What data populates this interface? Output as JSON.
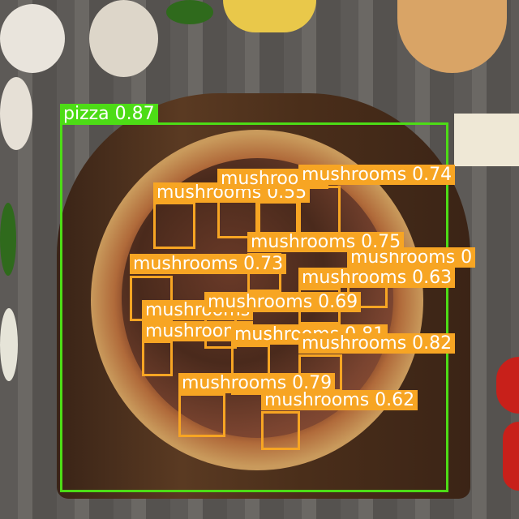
{
  "detections": [
    {
      "label": "pizza 0.87",
      "color": "#4ddc16"
    },
    {
      "label": "mushrooms 0.55",
      "color": "#f7a523"
    },
    {
      "label": "mushrooms",
      "color": "#f7a523"
    },
    {
      "label": "mushrooms 0.74",
      "color": "#f7a523"
    },
    {
      "label": "mushrooms 0.75",
      "color": "#f7a523"
    },
    {
      "label": "mushrooms 0",
      "color": "#f7a523"
    },
    {
      "label": "mushrooms 0.73",
      "color": "#f7a523"
    },
    {
      "label": "mushrooms 0.63",
      "color": "#f7a523"
    },
    {
      "label": "mushrooms",
      "color": "#f7a523"
    },
    {
      "label": "mushrooms 0.69",
      "color": "#f7a523"
    },
    {
      "label": "mushrooms",
      "color": "#f7a523"
    },
    {
      "label": "mushrooms 0.81",
      "color": "#f7a523"
    },
    {
      "label": "mushrooms 0.82",
      "color": "#f7a523"
    },
    {
      "label": "mushrooms 0.79",
      "color": "#f7a523"
    },
    {
      "label": "mushrooms 0.62",
      "color": "#f7a523"
    }
  ]
}
